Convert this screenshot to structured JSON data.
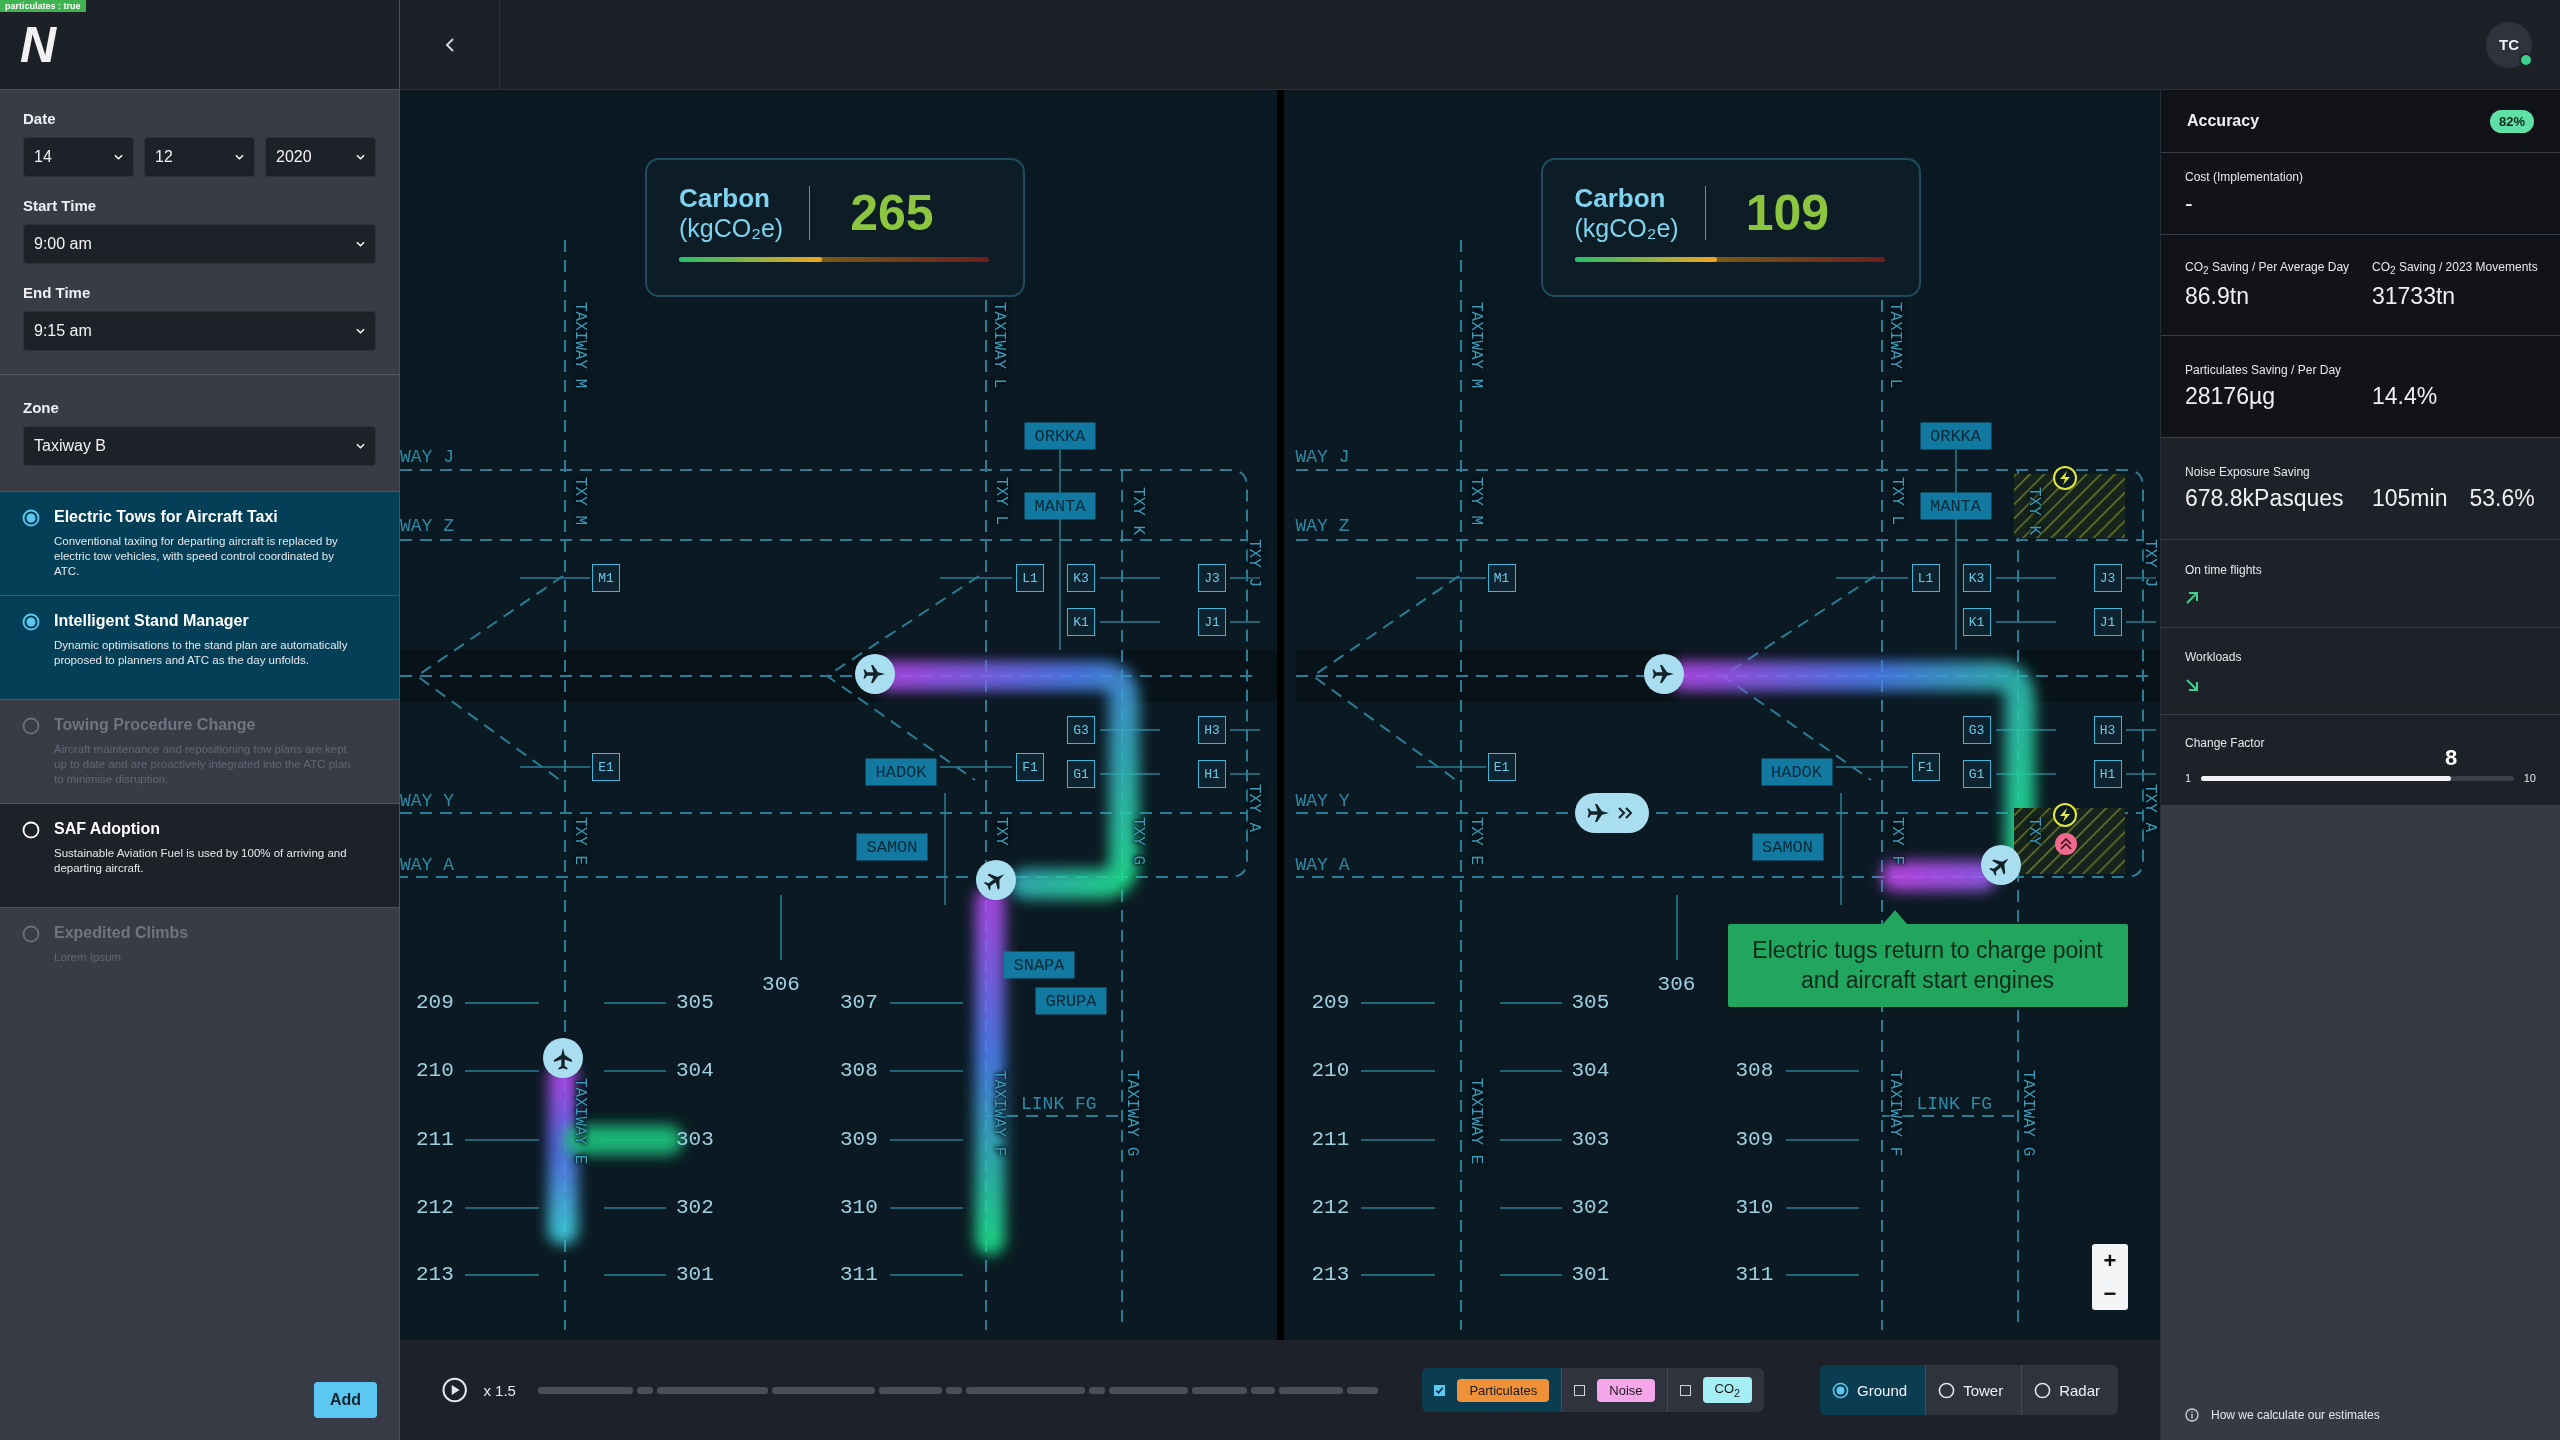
{
  "debug_badge": "particulates : true",
  "logo": "N",
  "sidebar": {
    "date": {
      "label": "Date",
      "day": "14",
      "month": "12",
      "year": "2020"
    },
    "start_time": {
      "label": "Start Time",
      "value": "9:00 am"
    },
    "end_time": {
      "label": "End Time",
      "value": "9:15 am"
    },
    "zone": {
      "label": "Zone",
      "value": "Taxiway B"
    },
    "scenarios": [
      {
        "title": "Electric Tows for Aircraft Taxi",
        "description": "Conventional taxiing for departing aircraft is replaced by electric tow vehicles, with speed control coordinated by ATC.",
        "selected": true,
        "disabled": false
      },
      {
        "title": "Intelligent Stand Manager",
        "description": "Dynamic optimisations to the stand plan are automatically proposed to planners and ATC as the day unfolds.",
        "selected": true,
        "disabled": false
      },
      {
        "title": "Towing Procedure Change",
        "description": "Aircraft maintenance and repositioning tow plans are kept up to date and are proactively integrated into the ATC plan to minimise disruption.",
        "selected": false,
        "disabled": true
      },
      {
        "title": "SAF Adoption",
        "description": "Sustainable Aviation Fuel is used by 100% of arriving and departing aircraft.",
        "selected": false,
        "disabled": false
      },
      {
        "title": "Expedited Climbs",
        "description": "Lorem Ipsum",
        "selected": false,
        "disabled": true
      }
    ],
    "add_button": "Add"
  },
  "avatar": {
    "initials": "TC",
    "online": true
  },
  "maps": [
    {
      "carbon": {
        "label": "Carbon",
        "unit": "(kgCO₂e)",
        "value": "265",
        "level": 0.46
      },
      "way_labels": [
        "WAY J",
        "WAY Z",
        "WAY Y",
        "WAY A",
        "LINK FG"
      ],
      "taxiway_labels": [
        "TAXIWAY M",
        "TAXIWAY L",
        "TXY M",
        "TXY L",
        "TXY K",
        "TXY J",
        "TXY E",
        "TXY",
        "TXY G",
        "TXY A",
        "TAXIWAY E",
        "TAXIWAY F",
        "TAXIWAY G"
      ],
      "stand_tags": [
        "M1",
        "L1",
        "K3",
        "J3",
        "K1",
        "J1",
        "G3",
        "H3",
        "E1",
        "F1",
        "G1",
        "H1"
      ],
      "name_tags": [
        "ORKKA",
        "MANTA",
        "HADOK",
        "SAMON",
        "SNAPA",
        "GRUPA"
      ],
      "stand_rows": [
        [
          "209",
          "305",
          "307"
        ],
        [
          "210",
          "304",
          "308"
        ],
        [
          "211",
          "303",
          "309"
        ],
        [
          "212",
          "302",
          "310"
        ],
        [
          "213",
          "301",
          "311"
        ]
      ],
      "center_stand": "306",
      "aircraft": [
        {
          "kind": "marker"
        },
        {
          "kind": "marker"
        },
        {
          "kind": "marker"
        }
      ],
      "charging_zones": false
    },
    {
      "carbon": {
        "label": "Carbon",
        "unit": "(kgCO₂e)",
        "value": "109",
        "level": 0.46
      },
      "way_labels": [
        "WAY J",
        "WAY Z",
        "WAY Y",
        "WAY A",
        "LINK FG"
      ],
      "taxiway_labels": [
        "TAXIWAY M",
        "TAXIWAY L",
        "TXY M",
        "TXY L",
        "TXY K",
        "TXY J",
        "TXY E",
        "TXY F",
        "TXY",
        "TXY A",
        "TAXIWAY E",
        "TAXIWAY F",
        "TAXIWAY G"
      ],
      "stand_tags": [
        "M1",
        "L1",
        "K3",
        "J3",
        "K1",
        "J1",
        "G3",
        "H3",
        "E1",
        "F1",
        "G1",
        "H1"
      ],
      "name_tags": [
        "ORKKA",
        "MANTA",
        "HADOK",
        "SAMON"
      ],
      "stand_rows": [
        [
          "209",
          "305"
        ],
        [
          "210",
          "304",
          "308"
        ],
        [
          "211",
          "303",
          "309"
        ],
        [
          "212",
          "302",
          "310"
        ],
        [
          "213",
          "301",
          "311"
        ]
      ],
      "center_stand": "306",
      "aircraft": [
        {
          "kind": "marker"
        },
        {
          "kind": "pill"
        },
        {
          "kind": "marker"
        }
      ],
      "charging_zones": true,
      "tooltip": "Electric tugs return to charge point and aircraft start engines",
      "zoom_controls": [
        "+",
        "−"
      ]
    }
  ],
  "playback": {
    "speed": "x 1.5"
  },
  "layers": [
    {
      "label": "Particulates",
      "checked": true,
      "color": "#f0913a"
    },
    {
      "label": "Noise",
      "checked": false,
      "color": "#f4a6e8"
    },
    {
      "label": "CO$_{2}$",
      "checked": false,
      "color": "#a5eef3"
    }
  ],
  "views": [
    {
      "label": "Ground",
      "selected": true
    },
    {
      "label": "Tower",
      "selected": false
    },
    {
      "label": "Radar",
      "selected": false
    }
  ],
  "stats": {
    "accuracy": {
      "label": "Accuracy",
      "value": "82%"
    },
    "metrics": [
      {
        "kind": "values",
        "labels": [
          "Cost (Implementation)"
        ],
        "values": [
          "-"
        ]
      },
      {
        "kind": "values",
        "labels": [
          "CO$_{2}$ Saving / Per Average Day",
          "CO$_{2}$ Saving / 2023 Movements"
        ],
        "values": [
          "86.9tn",
          "31733tn"
        ]
      },
      {
        "kind": "values",
        "labels": [
          "Particulates Saving / Per Day"
        ],
        "values": [
          "28176µg",
          "14.4%"
        ]
      },
      {
        "kind": "values",
        "labels": [
          "Noise Exposure Saving"
        ],
        "values": [
          "678.8kPasques",
          "105min",
          "53.6%"
        ]
      },
      {
        "kind": "trend",
        "label": "On time flights",
        "rising": true
      },
      {
        "kind": "trend",
        "label": "Workloads",
        "rising": false
      },
      {
        "kind": "slider",
        "label": "Change Factor",
        "value": "8",
        "min": "1",
        "max": "10",
        "level": 0.8
      }
    ],
    "info": "How we calculate our estimates"
  }
}
